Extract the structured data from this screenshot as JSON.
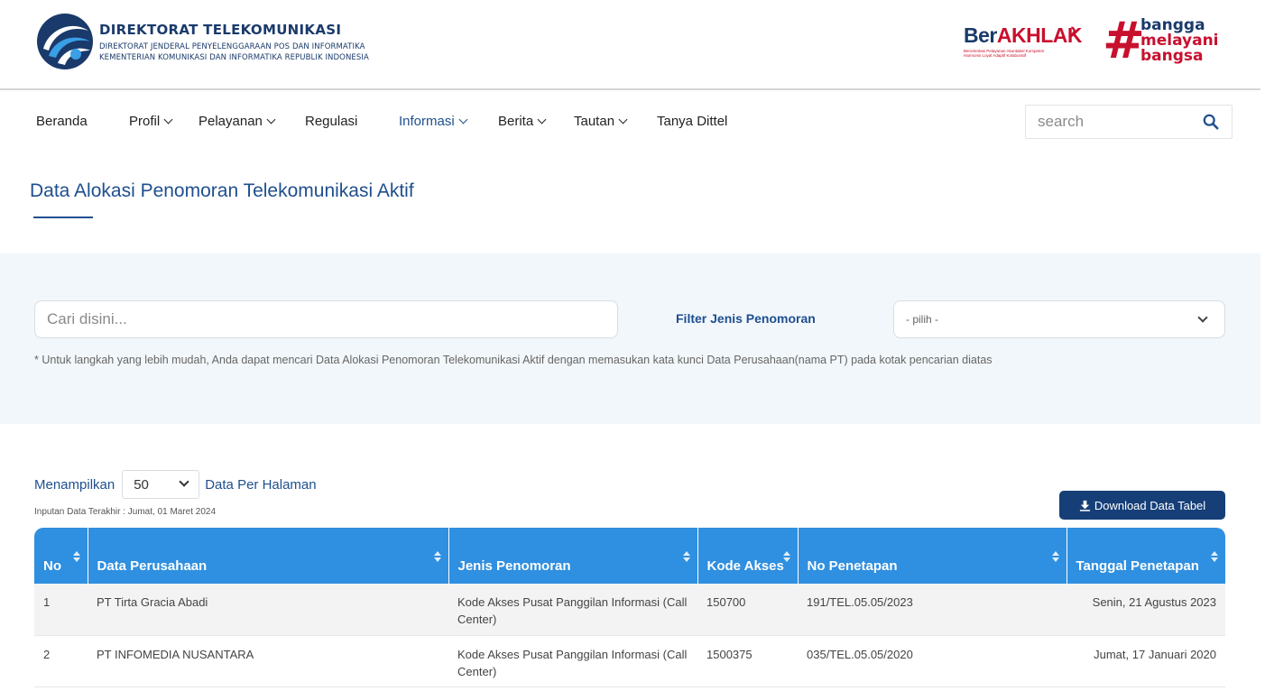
{
  "header": {
    "title": "DIREKTORAT TELEKOMUNIKASI",
    "subtitle1": "DIREKTORAT JENDERAL PENYELENGGARAAN POS DAN INFORMATIKA",
    "subtitle2": "KEMENTERIAN KOMUNIKASI DAN INFORMATIKA REPUBLIK INDONESIA",
    "berakhlak_word_a": "Ber",
    "berakhlak_word_b": "AKHLAK",
    "berakhlak_sub1": "Berorientasi Pelayanan Akuntabel Kompeten",
    "berakhlak_sub2": "Harmonis Loyal Adaptif Kolaboratif",
    "bangga_1": "bangga",
    "bangga_2": "melayani",
    "bangga_3": "bangsa"
  },
  "nav": {
    "items": [
      {
        "label": "Beranda",
        "dropdown": false
      },
      {
        "label": "Profil",
        "dropdown": true
      },
      {
        "label": "Pelayanan",
        "dropdown": true
      },
      {
        "label": "Regulasi",
        "dropdown": false
      },
      {
        "label": "Informasi",
        "dropdown": true,
        "active": true
      },
      {
        "label": "Berita",
        "dropdown": true
      },
      {
        "label": "Tautan",
        "dropdown": true
      },
      {
        "label": "Tanya Dittel",
        "dropdown": false
      }
    ],
    "search_placeholder": "search"
  },
  "page": {
    "title": "Data Alokasi Penomoran Telekomunikasi Aktif"
  },
  "filter": {
    "search_placeholder": "Cari disini...",
    "label": "Filter Jenis Penomoran",
    "select_value": "- pilih -",
    "note": "* Untuk langkah yang lebih mudah, Anda dapat mencari Data Alokasi Penomoran Telekomunikasi Aktif dengan memasukan kata kunci Data Perusahaan(nama PT) pada kotak pencarian diatas"
  },
  "table_controls": {
    "show_label": "Menampilkan",
    "page_size": "50",
    "per_page_label": "Data Per Halaman",
    "last_input": "Inputan Data Terakhir : Jumat, 01 Maret 2024",
    "download_label": "Download Data Tabel"
  },
  "table": {
    "columns": [
      "No",
      "Data Perusahaan",
      "Jenis Penomoran",
      "Kode Akses",
      "No Penetapan",
      "Tanggal Penetapan"
    ],
    "rows": [
      [
        "1",
        "PT Tirta Gracia Abadi",
        "Kode Akses Pusat Panggilan Informasi (Call Center)",
        "150700",
        "191/TEL.05.05/2023",
        "Senin, 21 Agustus 2023"
      ],
      [
        "2",
        "PT INFOMEDIA NUSANTARA",
        "Kode Akses Pusat Panggilan Informasi (Call Center)",
        "1500375",
        "035/TEL.05.05/2020",
        "Jumat, 17 Januari 2020"
      ]
    ]
  },
  "colors": {
    "primary": "#1f4f8f",
    "table_header": "#2f8fe0",
    "download_button": "#163f78",
    "panel_bg": "#f2f7fb",
    "accent_red": "#c8102e"
  }
}
